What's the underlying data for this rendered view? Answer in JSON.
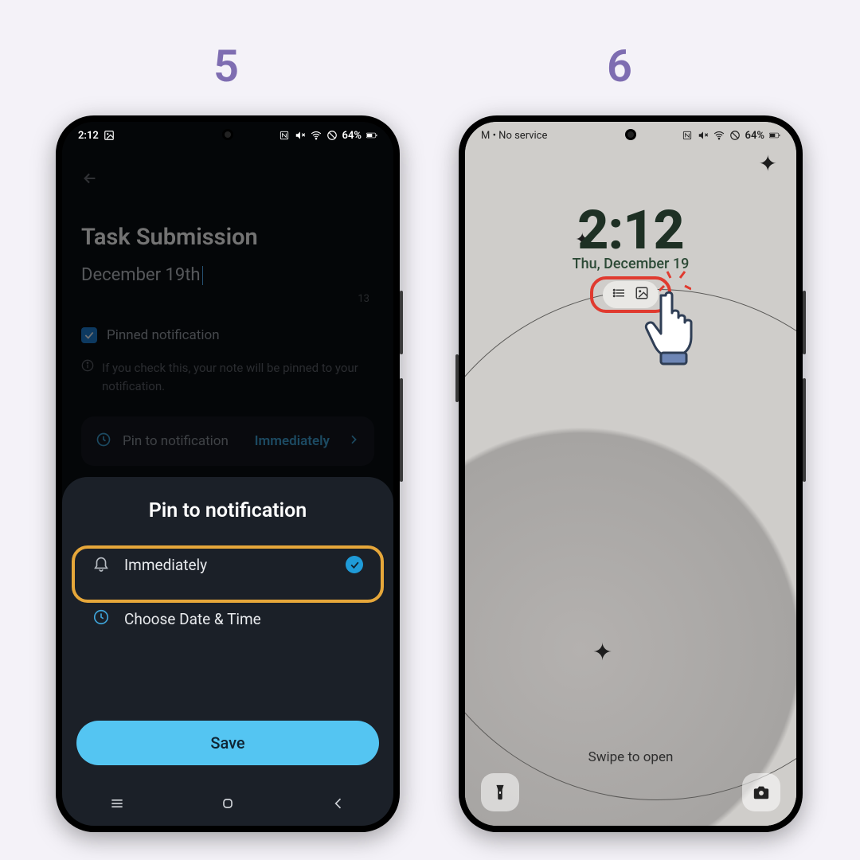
{
  "steps": {
    "left": "5",
    "right": "6"
  },
  "left": {
    "status": {
      "time": "2:12",
      "battery": "64%"
    },
    "title": "Task Submission",
    "date_value": "December 19th",
    "char_count": "13",
    "pinned_label": "Pinned notification",
    "pinned_note": "If you check this, your note will be pinned to your notification.",
    "pin_row_label": "Pin to notification",
    "pin_row_value": "Immediately",
    "sheet_title": "Pin to notification",
    "opt_immediately": "Immediately",
    "opt_choose": "Choose Date & Time",
    "save": "Save"
  },
  "right": {
    "status": {
      "carrier": "M • No service",
      "battery": "64%"
    },
    "lock_time": "2:12",
    "lock_date": "Thu, December 19",
    "swipe": "Swipe to open"
  }
}
